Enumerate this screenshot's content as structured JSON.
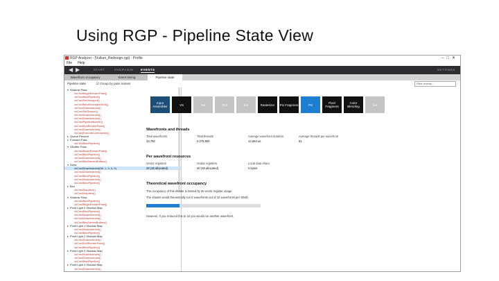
{
  "slide": {
    "title": "Using RGP - Pipeline State View",
    "accent_colors": [
      "#1c4e78",
      "#6fcf97"
    ]
  },
  "window": {
    "title": "RGP Analyzer - [Vulkan_Redesign.rgp] - Profile",
    "controls": [
      "–",
      "□",
      "✕"
    ]
  },
  "menu": [
    "File",
    "Help"
  ],
  "nav": {
    "tabs": [
      {
        "label": "START",
        "active": false
      },
      {
        "label": "OVERVIEW",
        "active": false
      },
      {
        "label": "EVENTS",
        "active": true
      }
    ],
    "settings": "SETTINGS"
  },
  "subtabs": [
    "Wavefront occupancy",
    "Event timing",
    "Pipeline state"
  ],
  "filter": {
    "left": "Pipeline state",
    "checkbox": "☑ Group by pass names",
    "placeholder": "Filter events..."
  },
  "tree": [
    {
      "t": "Shadow Pass",
      "c": "dark",
      "d": 0,
      "exp": true
    },
    {
      "t": "vkCmdBeginRenderPass()",
      "c": "red",
      "d": 1
    },
    {
      "t": "vkCmdBindPipeline()",
      "c": "red",
      "d": 1
    },
    {
      "t": "vkCmdSetViewport()",
      "c": "red",
      "d": 1
    },
    {
      "t": "vkCmdBindDescriptorSets()",
      "c": "red",
      "d": 1
    },
    {
      "t": "vkCmdDrawIndexed()",
      "c": "red",
      "d": 1
    },
    {
      "t": "vkCmdSetScissor()",
      "c": "red",
      "d": 1
    },
    {
      "t": "vkCmdDrawIndexed()",
      "c": "red",
      "d": 1
    },
    {
      "t": "vkCmdDrawIndexed()",
      "c": "red",
      "d": 1
    },
    {
      "t": "vkCmdPipelineBarrier()",
      "c": "red",
      "d": 1
    },
    {
      "t": "vkCmdEndRenderPass()",
      "c": "red",
      "d": 1
    },
    {
      "t": "vkCmdDrawIndexed()",
      "c": "red",
      "d": 1
    },
    {
      "t": "vkCmdExecuteCommands()",
      "c": "red",
      "d": 1
    },
    {
      "t": "Queue Present",
      "c": "dark",
      "d": 0,
      "exp": false
    },
    {
      "t": "Forward Pass",
      "c": "dark",
      "d": 0,
      "exp": false
    },
    {
      "t": "vkCmdBindPipeline()",
      "c": "red",
      "d": 1
    },
    {
      "t": "GBuffer Pass",
      "c": "dark",
      "d": 0,
      "exp": true
    },
    {
      "t": "vkCmdBeginRenderPass()",
      "c": "red",
      "d": 1
    },
    {
      "t": "vkCmdBindPipeline()",
      "c": "red",
      "d": 1
    },
    {
      "t": "vkCmdDrawIndexed()",
      "c": "red",
      "d": 1
    },
    {
      "t": "vkCmdBindVertexBuffers()",
      "c": "red",
      "d": 1
    },
    {
      "t": "Draw",
      "c": "dark",
      "d": 0,
      "exp": true
    },
    {
      "t": "vkCmdDrawIndexed(36, 1, 0, 0, 0)",
      "c": "dark",
      "d": 1,
      "sel": true
    },
    {
      "t": "vkCmdDrawIndexed()",
      "c": "red",
      "d": 1
    },
    {
      "t": "vkCmdBindPipeline()",
      "c": "red",
      "d": 1
    },
    {
      "t": "vkCmdDrawIndexed()",
      "c": "red",
      "d": 1
    },
    {
      "t": "vkCmdBindPipeline()",
      "c": "red",
      "d": 1
    },
    {
      "t": "Blur",
      "c": "dark",
      "d": 0,
      "exp": false
    },
    {
      "t": "vkCmdDispatch()",
      "c": "red",
      "d": 1
    },
    {
      "t": "vkCmdDispatch()",
      "c": "red",
      "d": 1
    },
    {
      "t": "Shadow Pass",
      "c": "dark",
      "d": 0,
      "exp": true
    },
    {
      "t": "vkCmdBindPipeline()",
      "c": "red",
      "d": 1
    },
    {
      "t": "vkCmdBeginRenderPass()",
      "c": "red",
      "d": 1
    },
    {
      "t": "Point Light 0 Shadow Map",
      "c": "dark",
      "d": 0,
      "exp": false
    },
    {
      "t": "vkCmdBindPipeline()",
      "c": "red",
      "d": 1
    },
    {
      "t": "vkCmdDrawIndexed()",
      "c": "red",
      "d": 1
    },
    {
      "t": "vkCmdDrawIndexed()",
      "c": "red",
      "d": 1
    },
    {
      "t": "vkCmdBindVertexBuffers()",
      "c": "red",
      "d": 1
    },
    {
      "t": "Point Light 1 Shadow Map",
      "c": "dark",
      "d": 0,
      "exp": false
    },
    {
      "t": "vkCmdDrawIndexed()",
      "c": "red",
      "d": 1
    },
    {
      "t": "vkCmdBindPipeline()",
      "c": "red",
      "d": 1
    },
    {
      "t": "Point Light 2 Shadow Map",
      "c": "dark",
      "d": 0,
      "exp": false
    },
    {
      "t": "vkCmdDrawIndexed()",
      "c": "red",
      "d": 1
    },
    {
      "t": "vkCmdEndRenderPass()",
      "c": "red",
      "d": 1
    },
    {
      "t": "vkCmdBindPipeline()",
      "c": "red",
      "d": 1
    },
    {
      "t": "Point Light 3 Shadow Map",
      "c": "dark",
      "d": 0,
      "exp": false
    },
    {
      "t": "vkCmdDrawIndexed()",
      "c": "red",
      "d": 1
    },
    {
      "t": "vkCmdDrawIndexed()",
      "c": "red",
      "d": 1
    },
    {
      "t": "vkCmdBindPipeline()",
      "c": "red",
      "d": 1
    },
    {
      "t": "Point Light 4 Shadow Map",
      "c": "dark",
      "d": 0,
      "exp": false
    },
    {
      "t": "vkCmdDrawIndexed()",
      "c": "red",
      "d": 1
    }
  ],
  "pipeline": [
    {
      "label": "Input Assembler",
      "style": "darkblue"
    },
    {
      "label": "VS",
      "style": "dark"
    },
    {
      "label": "HS",
      "style": "gray"
    },
    {
      "label": "TES",
      "style": "gray"
    },
    {
      "label": "GS",
      "style": "gray"
    },
    {
      "label": "Rasterizer",
      "style": "dark"
    },
    {
      "label": "Pix Fragment",
      "style": "dark"
    },
    {
      "label": "PS",
      "style": "blue"
    },
    {
      "label": "Pixel Fragment",
      "style": "dark"
    },
    {
      "label": "Color Blending",
      "style": "dark"
    },
    {
      "label": "CS",
      "style": "gray"
    }
  ],
  "wavefronts": {
    "heading": "Wavefronts and threads",
    "items": [
      {
        "label": "Total wavefronts",
        "value": "33,780"
      },
      {
        "label": "Total threads",
        "value": "2,075,900"
      },
      {
        "label": "Average wavefront duration",
        "value": "12,654 us"
      },
      {
        "label": "Average threads per wavefront",
        "value": "61"
      }
    ]
  },
  "resources": {
    "heading": "Per wavefront resources",
    "items": [
      {
        "label": "Vector registers",
        "value": "48 (48 allocated)"
      },
      {
        "label": "Scalar registers",
        "value": "40 (48 allocated)"
      },
      {
        "label": "Local data share",
        "value": "0 bytes"
      }
    ]
  },
  "occupancy": {
    "heading": "Theoretical wavefront occupancy",
    "line1": "The occupancy of this shader is limited by its vector register usage.",
    "line2": "The shader would theoretically run 5 wavefronts out of 10 wavefronts per SIMD.",
    "fill_fraction": 0.5,
    "line3": "However, if you reduced this to 16 you would run another wavefront."
  }
}
